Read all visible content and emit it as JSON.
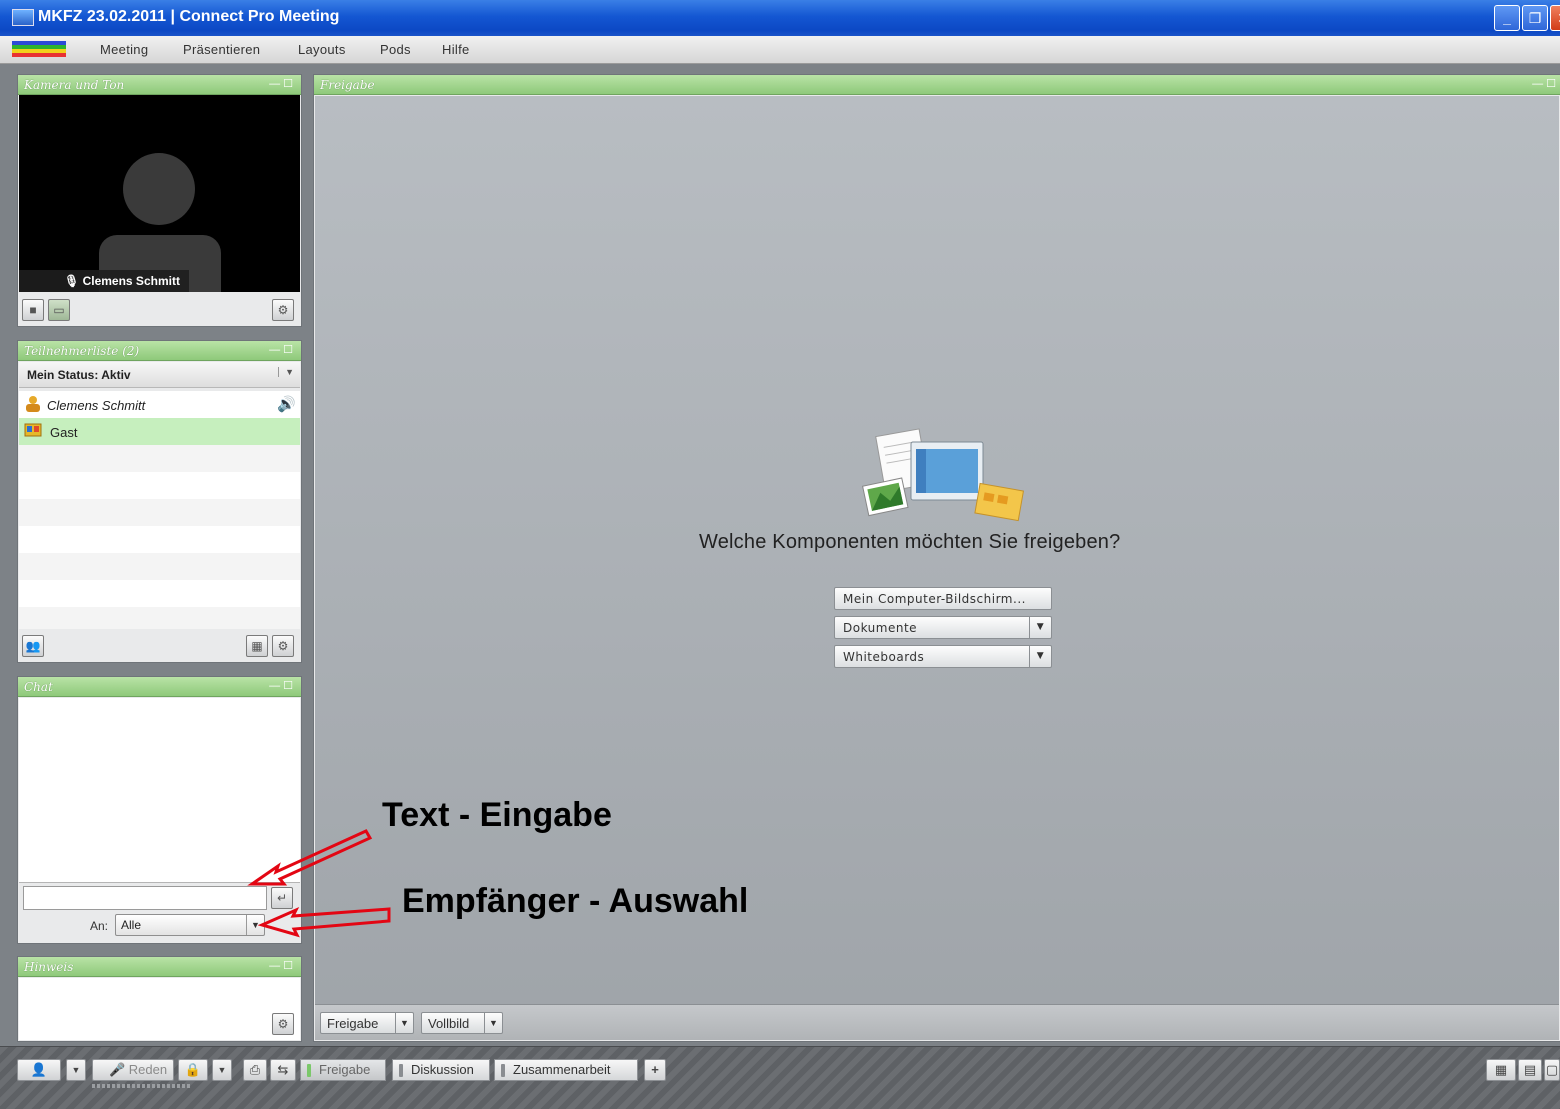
{
  "window": {
    "title": "MKFZ 23.02.2011 | Connect Pro Meeting",
    "controls": [
      "minimize",
      "restore",
      "close"
    ]
  },
  "menu": [
    "Meeting",
    "Präsentieren",
    "Layouts",
    "Pods",
    "Hilfe"
  ],
  "camera_pod": {
    "title": "Kamera und Ton",
    "speaker_name": "Clemens Schmitt"
  },
  "attendee_pod": {
    "title": "Teilnehmerliste (2)",
    "status": "Mein Status: Aktiv",
    "attendees": [
      {
        "name": "Clemens Schmitt",
        "role": "host",
        "icon": "host-icon"
      },
      {
        "name": "Gast",
        "role": "guest",
        "icon": "guest-icon"
      }
    ]
  },
  "chat_pod": {
    "title": "Chat",
    "input_value": "",
    "recipient_label": "An:",
    "recipient_value": "Alle"
  },
  "note_pod": {
    "title": "Hinweis"
  },
  "share_pod": {
    "title": "Freigabe",
    "question": "Welche Komponenten möchten Sie freigeben?",
    "options": [
      "Mein Computer-Bildschirm...",
      "Dokumente",
      "Whiteboards"
    ],
    "footer_share": "Freigabe",
    "footer_fullscreen": "Vollbild"
  },
  "bottom_bar": {
    "talk_label": "Reden",
    "layouts": [
      "Freigabe",
      "Diskussion",
      "Zusammenarbeit"
    ],
    "add_label": "+"
  },
  "annotations": {
    "text_input": "Text - Eingabe",
    "recipient_select": "Empfänger - Auswahl"
  },
  "colors": {
    "pod_header": "#9fd48a",
    "title_bar": "#1457d2",
    "annotation_arrow": "#e30613",
    "selected_row": "#c6efbe"
  }
}
